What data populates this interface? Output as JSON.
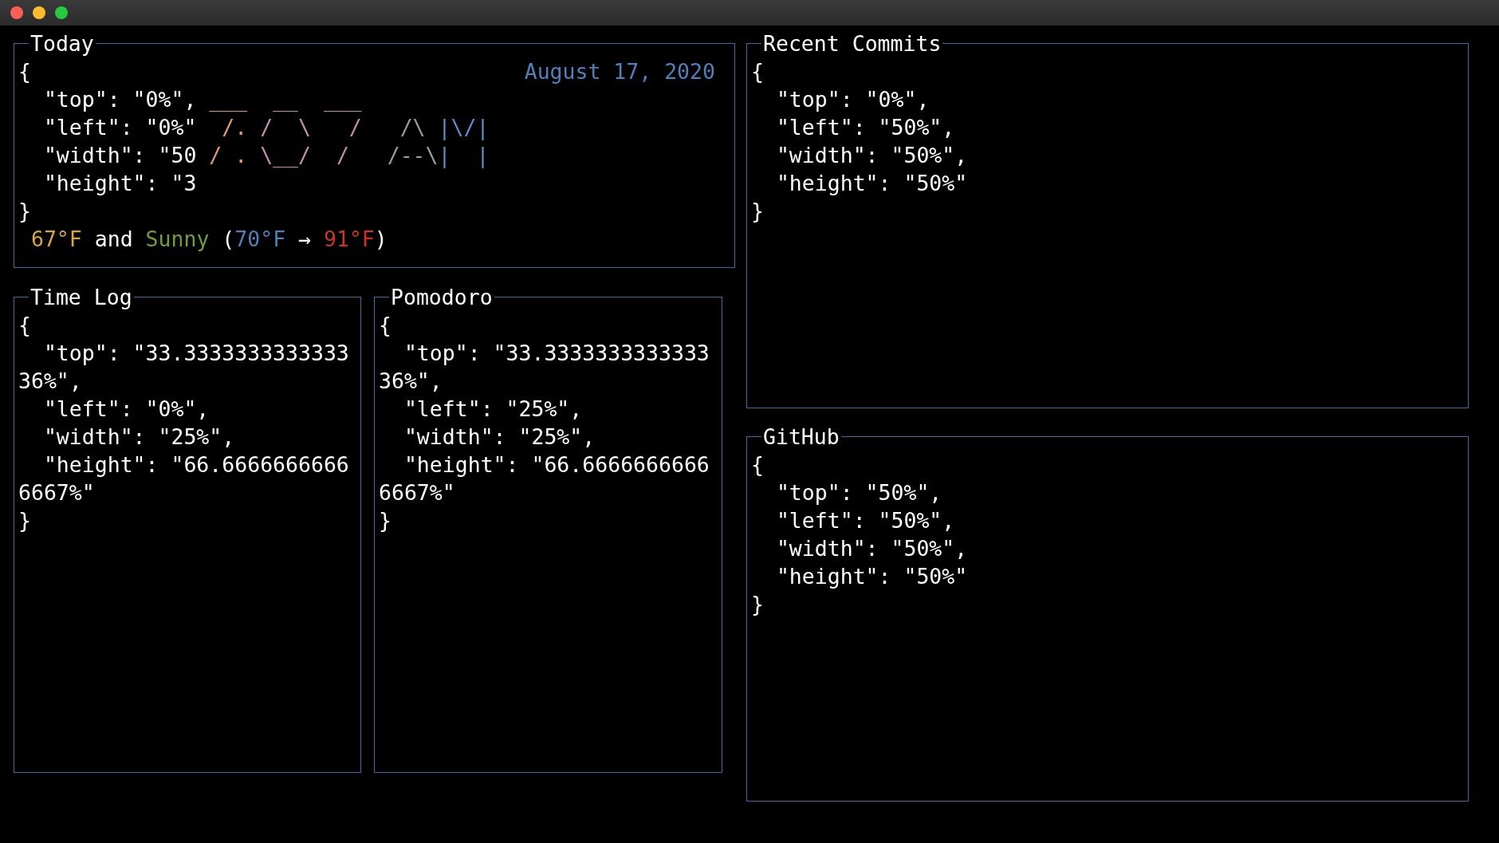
{
  "today": {
    "title": "Today",
    "open_brace": "{",
    "date": "August 17, 2020",
    "rows": [
      {
        "text": "  \"top\": \"0%\",",
        "art": [
          {
            "text": " ___",
            "color": "#e39a6c"
          },
          {
            "text": "  __",
            "color": "#c38cae"
          },
          {
            "text": "  ___",
            "color": "#c38cae"
          }
        ]
      },
      {
        "text": "  \"left\": \"0%\"",
        "art": [
          {
            "text": "  /.",
            "color": "#e39a6c"
          },
          {
            "text": " /  \\",
            "color": "#c38cae"
          },
          {
            "text": "   /",
            "color": "#c38cae"
          },
          {
            "text": "   /\\",
            "color": "#9a9a9a"
          },
          {
            "text": " |\\/|",
            "color": "#5b8fc9"
          }
        ]
      },
      {
        "text": "  \"width\": \"50",
        "art": [
          {
            "text": " / .",
            "color": "#e39a6c"
          },
          {
            "text": " \\__/",
            "color": "#c38cae"
          },
          {
            "text": "  /",
            "color": "#c38cae"
          },
          {
            "text": "   /--\\",
            "color": "#9a9a9a"
          },
          {
            "text": "|  |",
            "color": "#5b8fc9"
          }
        ]
      },
      {
        "text": "  \"height\": \"3",
        "art": []
      }
    ],
    "close_brace": "}",
    "weather": [
      {
        "text": "67°F",
        "color": "#d9a53c"
      },
      {
        "text": " and ",
        "color": "#ffffff"
      },
      {
        "text": "Sunny",
        "color": "#6f9f3c"
      },
      {
        "text": " (",
        "color": "#ffffff"
      },
      {
        "text": "70°F",
        "color": "#4f80b9"
      },
      {
        "text": " → ",
        "color": "#ffffff"
      },
      {
        "text": "91°F",
        "color": "#cc3525"
      },
      {
        "text": ")",
        "color": "#ffffff"
      }
    ]
  },
  "time_log": {
    "title": "Time Log",
    "lines": [
      "{",
      "  \"top\": \"33.3333333333333",
      "36%\",",
      "  \"left\": \"0%\",",
      "  \"width\": \"25%\",",
      "  \"height\": \"66.6666666666",
      "6667%\"",
      "}"
    ]
  },
  "pomodoro": {
    "title": "Pomodoro",
    "lines": [
      "{",
      "  \"top\": \"33.3333333333333",
      "36%\",",
      "  \"left\": \"25%\",",
      "  \"width\": \"25%\",",
      "  \"height\": \"66.6666666666",
      "6667%\"",
      "}"
    ]
  },
  "recent_commits": {
    "title": "Recent Commits",
    "lines": [
      "{",
      "  \"top\": \"0%\",",
      "  \"left\": \"50%\",",
      "  \"width\": \"50%\",",
      "  \"height\": \"50%\"",
      "}"
    ]
  },
  "github": {
    "title": "GitHub",
    "lines": [
      "{",
      "  \"top\": \"50%\",",
      "  \"left\": \"50%\",",
      "  \"width\": \"50%\",",
      "  \"height\": \"50%\"",
      "}"
    ]
  }
}
